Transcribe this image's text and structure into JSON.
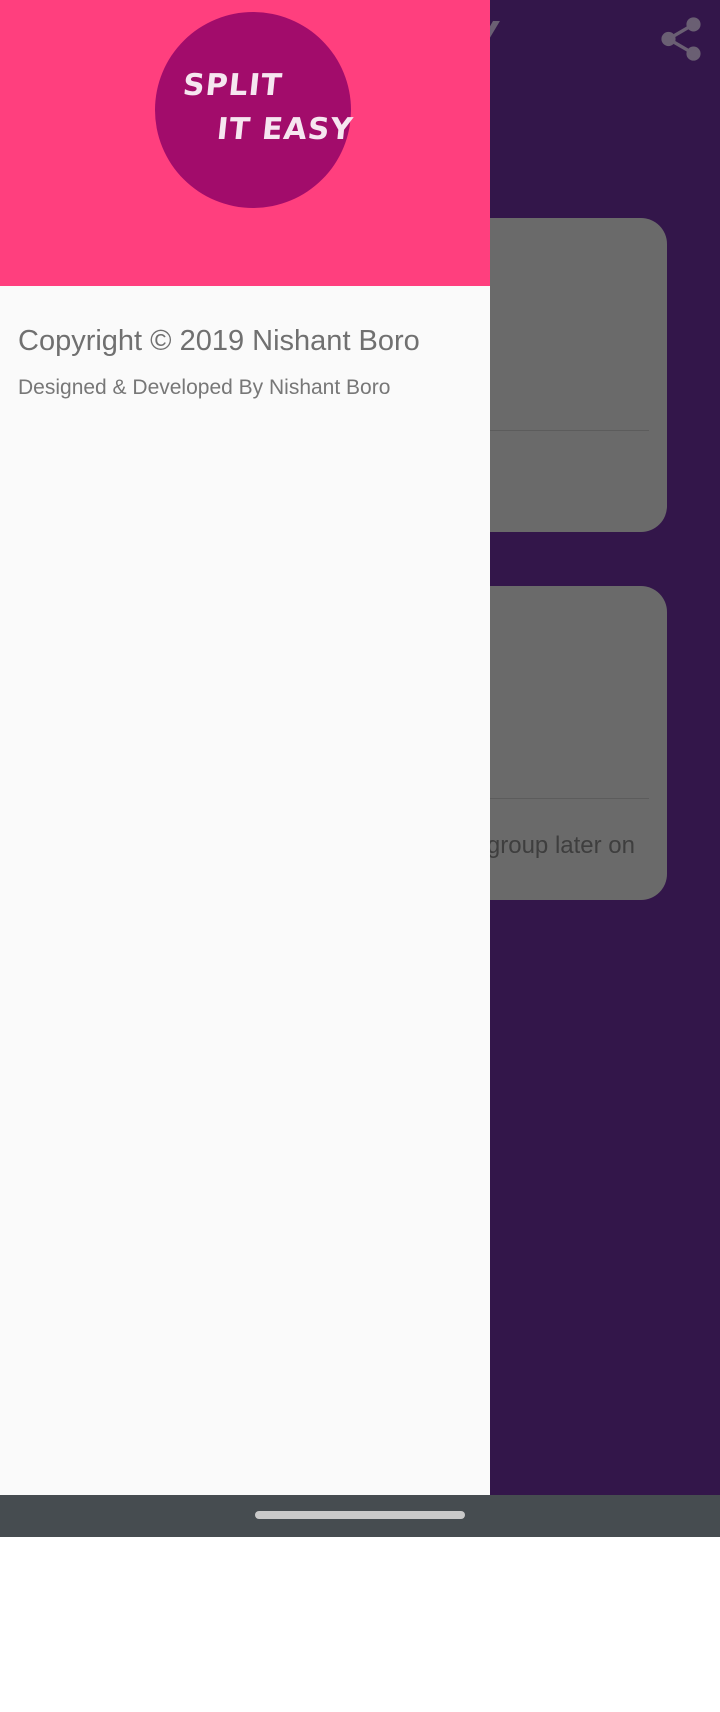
{
  "background_app": {
    "title_fragment": "Y",
    "share_icon": "share-icon",
    "cards": [
      {
        "text": ""
      },
      {
        "text": "group later on"
      }
    ],
    "colors": {
      "background": "#33164a",
      "card": "#6a6a6a"
    }
  },
  "drawer": {
    "logo": {
      "line1": "SPLIT",
      "line2": "IT EASY"
    },
    "copyright": "Copyright © 2019 Nishant Boro",
    "credit": "Designed & Developed By Nishant Boro",
    "colors": {
      "header": "#ff3f7e",
      "logo_circle": "#a20c6b",
      "body": "#fafafa"
    }
  },
  "nav_bar": {
    "color": "#464c50"
  }
}
